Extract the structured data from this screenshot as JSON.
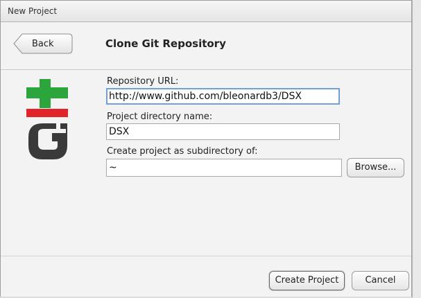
{
  "window": {
    "title": "New Project"
  },
  "header": {
    "back_label": "Back",
    "title": "Clone Git Repository"
  },
  "form": {
    "repo_url_label": "Repository URL:",
    "repo_url_value": "http://www.github.com/bleonardb3/DSX",
    "dir_name_label": "Project directory name:",
    "dir_name_value": "DSX",
    "subdir_label": "Create project as subdirectory of:",
    "subdir_value": "~",
    "browse_label": "Browse..."
  },
  "footer": {
    "create_label": "Create Project",
    "cancel_label": "Cancel"
  },
  "logo": {
    "icon": "git-logo-icon",
    "plus_color": "#2ca63c",
    "minus_color": "#e0242a",
    "g_color": "#3a3a3a"
  }
}
